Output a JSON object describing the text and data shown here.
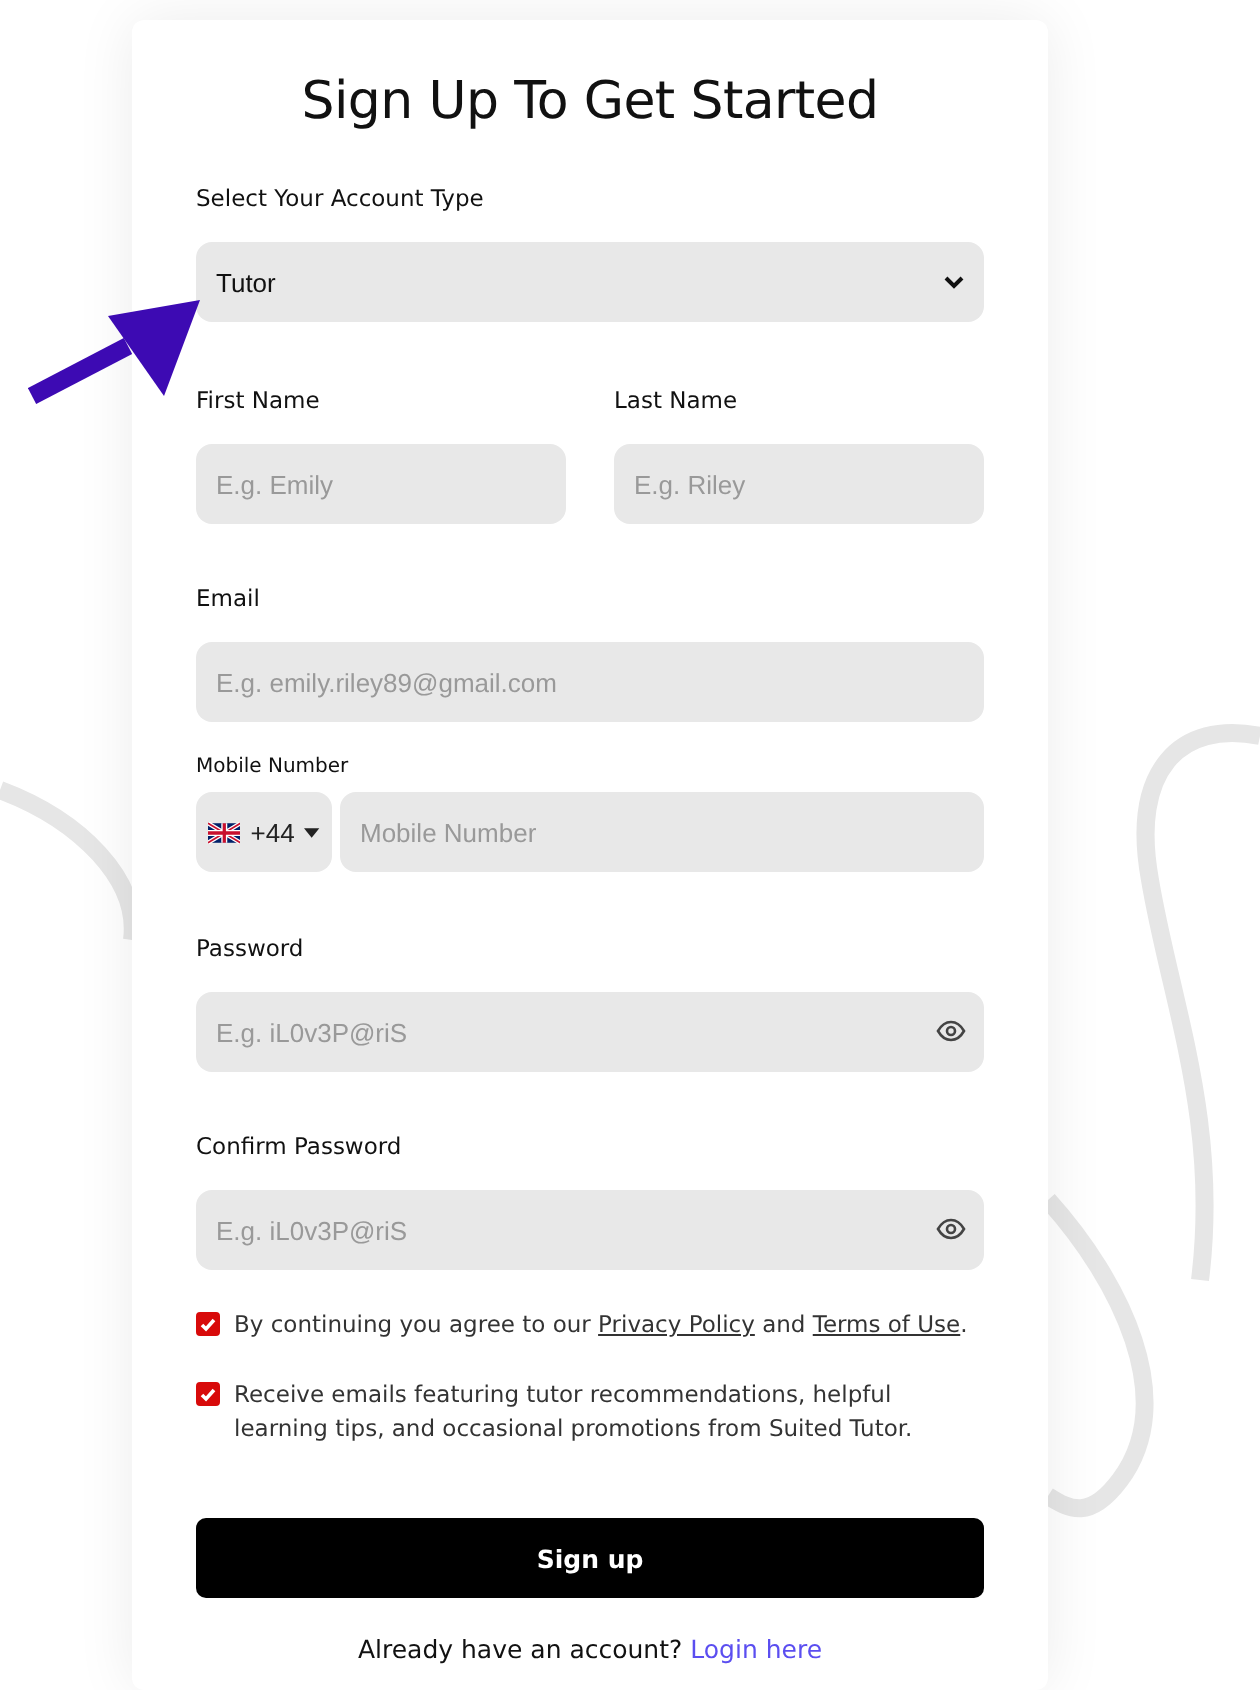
{
  "title": "Sign Up To Get Started",
  "account_type": {
    "label": "Select Your Account Type",
    "value": "Tutor"
  },
  "first_name": {
    "label": "First Name",
    "placeholder": "E.g. Emily"
  },
  "last_name": {
    "label": "Last Name",
    "placeholder": "E.g. Riley"
  },
  "email": {
    "label": "Email",
    "placeholder": "E.g. emily.riley89@gmail.com"
  },
  "mobile": {
    "label": "Mobile Number",
    "country_code": "+44",
    "placeholder": "Mobile Number"
  },
  "password": {
    "label": "Password",
    "placeholder": "E.g. iL0v3P@riS"
  },
  "confirm_password": {
    "label": "Confirm Password",
    "placeholder": "E.g. iL0v3P@riS"
  },
  "consents": [
    {
      "checked": true,
      "parts": [
        {
          "kind": "text",
          "text": "By continuing you agree to our "
        },
        {
          "kind": "link",
          "text": "Privacy Policy"
        },
        {
          "kind": "text",
          "text": " and "
        },
        {
          "kind": "link",
          "text": "Terms of Use"
        },
        {
          "kind": "text",
          "text": "."
        }
      ]
    },
    {
      "checked": true,
      "parts": [
        {
          "kind": "text",
          "text": "Receive emails featuring tutor recommendations, helpful learning tips, and occasional promotions from Suited Tutor."
        }
      ]
    }
  ],
  "submit": "Sign up",
  "footer": {
    "text": "Already have an account?",
    "link": "Login here"
  }
}
